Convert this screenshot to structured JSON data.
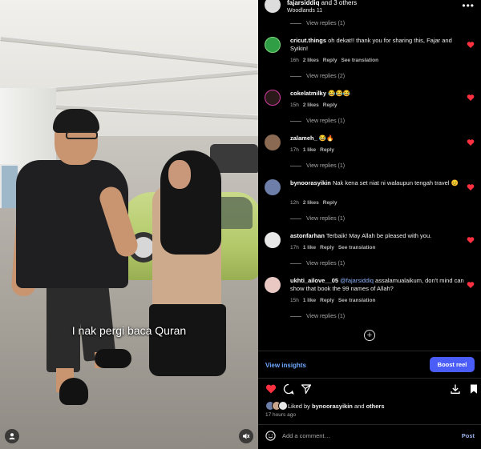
{
  "video": {
    "subtitle": "I nak pergi baca Quran"
  },
  "header": {
    "username": "fajarsiddiq",
    "others": " and 3 others",
    "location": "Woodlands 11",
    "more_icon": "ellipsis-icon"
  },
  "comments": [
    {
      "view_replies": "View replies (1)"
    },
    {
      "user": "cricut.things",
      "text": " oh dekat!! thank you for sharing this, Fajar and Syikin!",
      "age": "16h",
      "likes": "2 likes",
      "reply": "Reply",
      "translate": "See translation",
      "view_replies": "View replies (2)",
      "avatar_color": "#2f9e44"
    },
    {
      "user": "cokelatmilky",
      "text": " 😂😂😂",
      "age": "15h",
      "likes": "2 likes",
      "reply": "Reply",
      "view_replies": "View replies (1)",
      "avatar_color": "#2a1a1a"
    },
    {
      "user": "zalameh_",
      "text": " 😂🔥",
      "age": "17h",
      "likes": "1 like",
      "reply": "Reply",
      "view_replies": "View replies (1)",
      "avatar_color": "#8a6a52"
    },
    {
      "user": "bynoorasyikin",
      "text": " Nak kena set niat ni walaupun tengah travel 😊",
      "age": "12h",
      "likes": "2 likes",
      "reply": "Reply",
      "view_replies": "View replies (1)",
      "avatar_color": "#6d7fa8"
    },
    {
      "user": "astonfarhan",
      "text": " Terbaik! May Allah be pleased with you.",
      "age": "17h",
      "likes": "1 like",
      "reply": "Reply",
      "translate": "See translation",
      "view_replies": "View replies (1)",
      "avatar_color": "#e8e8e8"
    },
    {
      "user": "ukhti_ailove__05",
      "mention": " @fajarsiddiq",
      "text": " assalamualaikum, don't mind can show that book the 99 names of Allah?",
      "age": "15h",
      "likes": "1 like",
      "reply": "Reply",
      "translate": "See translation",
      "view_replies": "View replies (1)",
      "avatar_color": "#e9c8c4"
    }
  ],
  "footer": {
    "view_insights": "View insights",
    "boost": "Boost reel",
    "liked_by_prefix": "Liked by ",
    "liked_by_user": "bynoorasyikin",
    "liked_by_mid": " and ",
    "liked_by_others": "others",
    "time": "17 hours ago",
    "add_comment_placeholder": "Add a comment…",
    "post": "Post"
  },
  "colors": {
    "like_red": "#ff3040",
    "link_blue": "#6ea8ff",
    "boost_blue": "#4a5df9"
  }
}
